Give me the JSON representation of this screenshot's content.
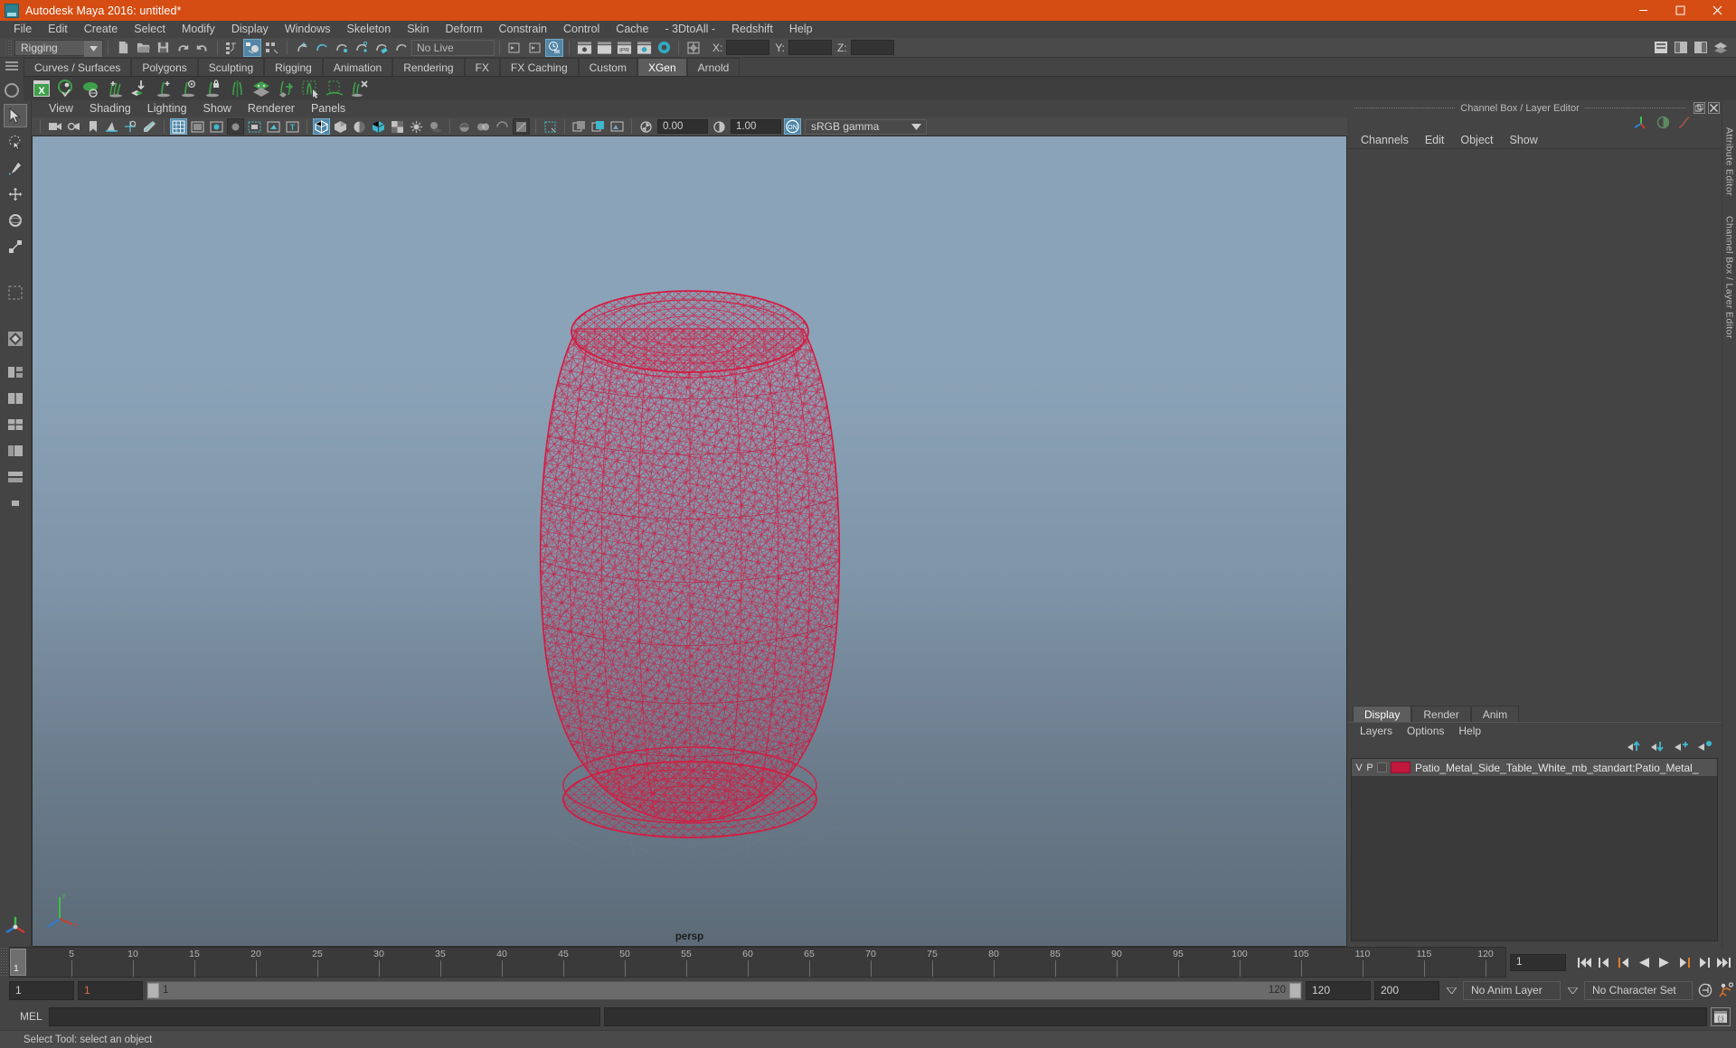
{
  "window": {
    "title": "Autodesk Maya 2016: untitled*",
    "controls": {
      "minimize": "minimize-icon",
      "maximize": "maximize-icon",
      "close": "close-icon"
    },
    "accent_color": "#d54d12"
  },
  "menubar": {
    "items": [
      "File",
      "Edit",
      "Create",
      "Select",
      "Modify",
      "Display",
      "Windows",
      "Skeleton",
      "Skin",
      "Deform",
      "Constrain",
      "Control",
      "Cache",
      "- 3DtoAll -",
      "Redshift",
      "Help"
    ]
  },
  "statusbar": {
    "mode_selector": "Rigging",
    "live_surface": "No Live Surface",
    "coords": {
      "x_label": "X:",
      "y_label": "Y:",
      "z_label": "Z:",
      "x_value": "",
      "y_value": "",
      "z_value": ""
    },
    "icons": [
      "new-scene-icon",
      "open-scene-icon",
      "save-scene-icon",
      "undo-icon",
      "redo-icon",
      "select-hierarchy-icon",
      "select-object-icon",
      "select-component-icon",
      "snap-grid-icon",
      "snap-curve-icon",
      "snap-point-icon",
      "snap-projected-icon",
      "snap-view-icon",
      "render-current-icon",
      "render-sequence-icon",
      "ipr-render-icon",
      "render-settings-icon",
      "hypershade-icon",
      "render-view-icon",
      "show-manipulator-icon"
    ],
    "right_icons": [
      "sidebar-attribute-icon",
      "sidebar-tool-icon",
      "sidebar-channel-icon",
      "sidebar-layer-icon"
    ]
  },
  "shelf": {
    "tabs": [
      "Curves / Surfaces",
      "Polygons",
      "Sculpting",
      "Rigging",
      "Animation",
      "Rendering",
      "FX",
      "FX Caching",
      "Custom",
      "XGen",
      "Arnold"
    ],
    "active_tab": "XGen",
    "icons": [
      "xgen-window-icon",
      "xgen-preview-icon",
      "xgen-patch-icon",
      "xgen-add-description-icon",
      "xgen-import-icon",
      "xgen-add-guide-icon",
      "xgen-guide-display-icon",
      "xgen-lock-guide-icon",
      "xgen-mirror-guide-icon",
      "xgen-sculpt-layers-icon",
      "xgen-flip-icon",
      "xgen-select-region-icon",
      "xgen-region-icon",
      "xgen-delete-guide-icon"
    ]
  },
  "toolbox": {
    "tools": [
      "select-tool",
      "lasso-select-tool",
      "paint-select-tool",
      "move-tool",
      "rotate-tool",
      "scale-tool",
      "soft-select-tool",
      "last-tool",
      "layout-single-icon",
      "layout-two-pane-icon",
      "layout-four-pane-icon",
      "layout-persp-outliner-icon",
      "layout-hypershade-icon",
      "layout-custom-icon"
    ],
    "active": "select-tool",
    "axis_widget": "origin-axis-indicator"
  },
  "viewport": {
    "menus": [
      "View",
      "Shading",
      "Lighting",
      "Show",
      "Renderer",
      "Panels"
    ],
    "camera_label": "persp",
    "toolbar": {
      "exposure_value": "0.00",
      "gamma_value": "1.00",
      "color_space": "sRGB gamma",
      "toggle_label": "ON",
      "icons": [
        "select-camera-icon",
        "lock-camera-icon",
        "bookmark-icon",
        "image-plane-icon",
        "two-d-pan-zoom-icon",
        "grease-pencil-icon",
        "grid-toggle-icon",
        "film-gate-icon",
        "resolution-gate-icon",
        "gate-mask-icon",
        "xray-joints-icon",
        "xray-icon",
        "texture-toggle-icon",
        "wireframe-shaded-icon",
        "smooth-shade-icon",
        "flat-shade-icon",
        "shaded-wireframe-icon",
        "texture-display-icon",
        "use-all-lights-icon",
        "shadows-icon",
        "ambient-occlusion-icon",
        "motion-blur-icon",
        "multisample-icon",
        "isolate-select-icon",
        "iso-display-icon",
        "snapshot-icon",
        "exposure-icon",
        "gamma-icon",
        "view-toggle-icon"
      ]
    },
    "scene": {
      "object_name": "Patio_Metal_Side_Table_White",
      "display_mode": "wireframe",
      "wire_color": "#d61a40",
      "background_top": "#8ba3b8",
      "background_bottom": "#5d6b78"
    }
  },
  "right_dock": {
    "panel_title": "Channel Box / Layer Editor",
    "channel_box": {
      "menus": [
        "Channels",
        "Edit",
        "Object",
        "Show"
      ]
    },
    "side_tabs": [
      "Attribute Editor",
      "Channel Box / Layer Editor"
    ],
    "layer_editor": {
      "tabs": [
        "Display",
        "Render",
        "Anim"
      ],
      "active_tab": "Display",
      "menus": [
        "Layers",
        "Options",
        "Help"
      ],
      "buttons": [
        "move-layer-up-icon",
        "move-layer-down-icon",
        "new-layer-icon",
        "new-layer-from-selected-icon"
      ],
      "layers": [
        {
          "visibility": "V",
          "playback": "P",
          "color": "#c2183c",
          "name": "Patio_Metal_Side_Table_White_mb_standart:Patio_Metal_"
        }
      ]
    }
  },
  "timeline": {
    "ticks": [
      "1",
      "5",
      "10",
      "15",
      "20",
      "25",
      "30",
      "35",
      "40",
      "45",
      "50",
      "55",
      "60",
      "65",
      "70",
      "75",
      "80",
      "85",
      "90",
      "95",
      "100",
      "105",
      "110",
      "115",
      "120"
    ],
    "current_frame": "1",
    "frame_field": "1",
    "playback_buttons": [
      "go-to-start-icon",
      "step-back-key-icon",
      "step-back-frame-icon",
      "play-backwards-icon",
      "play-forwards-icon",
      "step-forward-frame-icon",
      "step-forward-key-icon",
      "go-to-end-icon"
    ]
  },
  "range_slider": {
    "start_field": "1",
    "current_field": "1",
    "range_start_label": "1",
    "range_end_label": "120",
    "end_field": "120",
    "playback_end_field": "200",
    "anim_layer": "No Anim Layer",
    "character_set": "No Character Set",
    "icons": [
      "auto-key-icon",
      "animation-preferences-icon"
    ]
  },
  "command_line": {
    "label": "MEL",
    "input_value": "",
    "output_value": "",
    "script_editor_icon": "script-editor-icon"
  },
  "help_line": {
    "text": "Select Tool: select an object"
  }
}
